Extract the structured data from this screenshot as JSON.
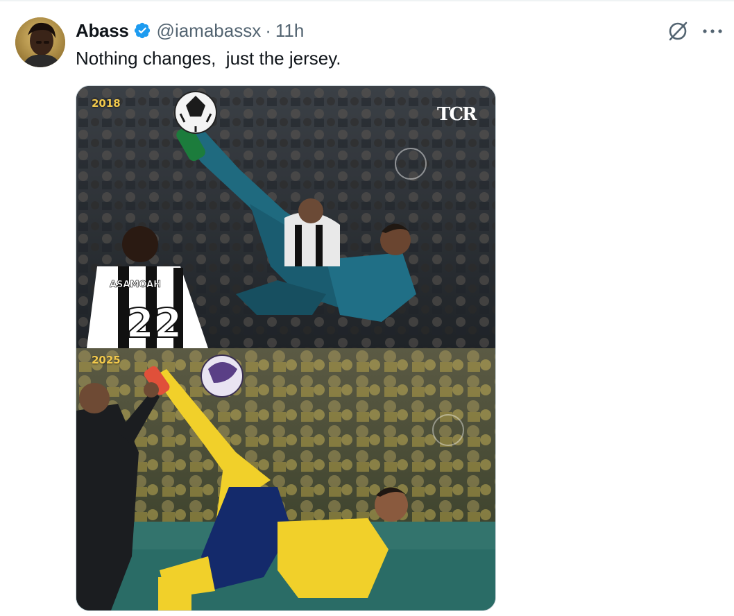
{
  "tweet": {
    "author": {
      "display_name": "Abass",
      "handle": "@iamabassx",
      "avatar_icon": "avatar",
      "verified_icon": "verified-badge-icon",
      "verified_color": "#1d9bf0"
    },
    "separator": "·",
    "timestamp": "11h",
    "text": "Nothing changes,  just the jersey.",
    "actions": {
      "grok_icon": "grok-icon",
      "more_icon": "more-icon"
    },
    "media": {
      "top": {
        "year": "2018",
        "watermark": "TCR",
        "jersey_name": "ASAMOAH",
        "jersey_number": "22"
      },
      "bottom": {
        "year": "2025"
      }
    }
  },
  "colors": {
    "text_primary": "#0f1419",
    "text_secondary": "#536471",
    "year_label": "#f2c94c",
    "border": "#cfd9de"
  }
}
